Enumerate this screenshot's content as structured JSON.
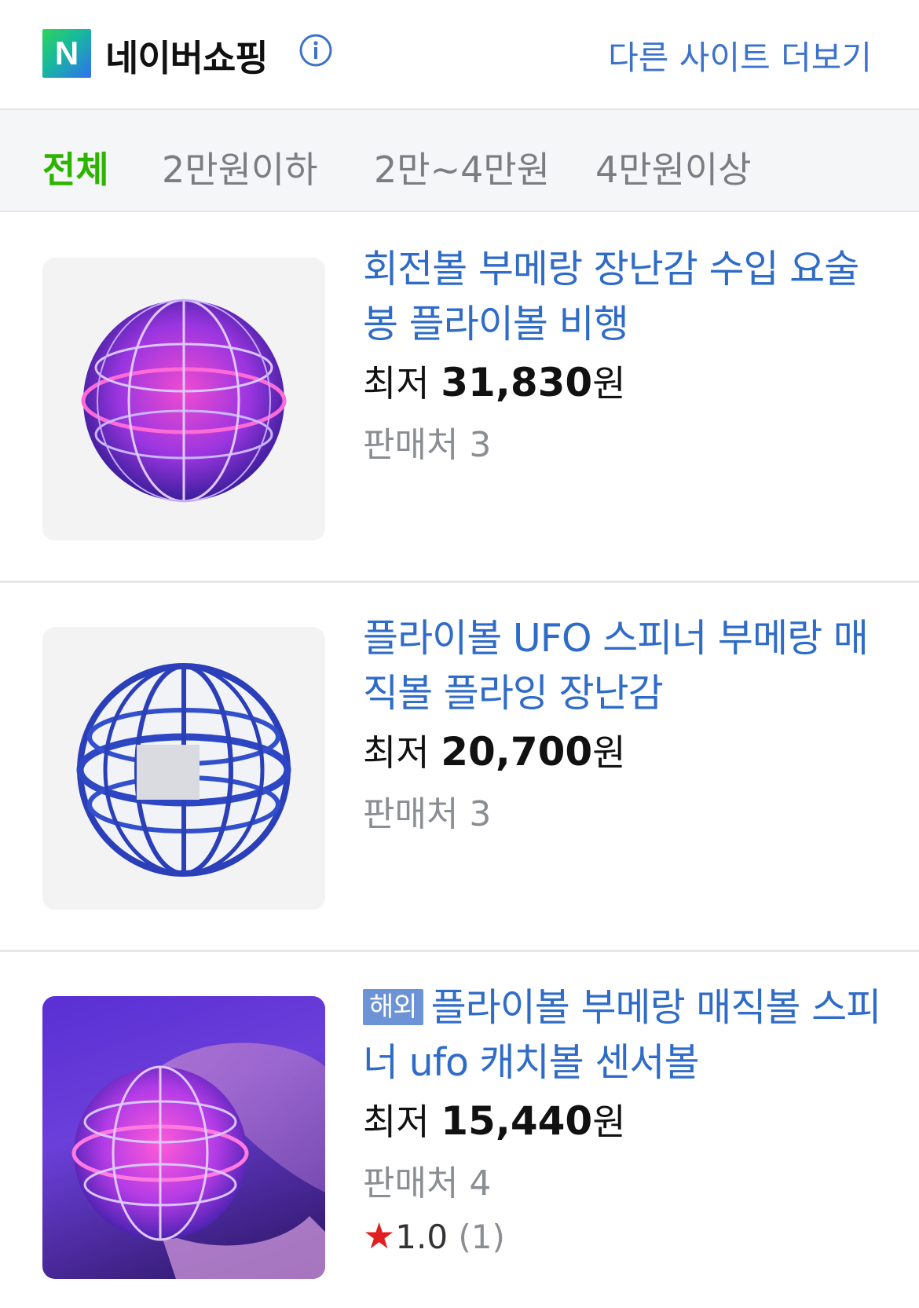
{
  "header": {
    "logo_letter": "N",
    "brand": "네이버쇼핑",
    "more_link": "다른 사이트 더보기"
  },
  "filters": [
    "전체",
    "2만원이하",
    "2만~4만원",
    "4만원이상"
  ],
  "items": [
    {
      "title": "회전볼 부메랑 장난감 수입 요술봉 플라이볼 비행",
      "price_prefix": "최저",
      "price": "31,830",
      "price_unit": "원",
      "sellers": "판매처 3"
    },
    {
      "title": "플라이볼 UFO 스피너 부메랑 매직볼 플라잉 장난감",
      "price_prefix": "최저",
      "price": "20,700",
      "price_unit": "원",
      "sellers": "판매처 3"
    },
    {
      "badge": "해외",
      "title": "플라이볼 부메랑 매직볼 스피너 ufo 캐치볼 센서볼",
      "price_prefix": "최저",
      "price": "15,440",
      "price_unit": "원",
      "sellers": "판매처 4",
      "rating_star": "★",
      "rating": "1.0",
      "rating_count": "(1)"
    }
  ],
  "colors": {
    "accent_green": "#2db400",
    "link_blue": "#2f6cc7"
  }
}
